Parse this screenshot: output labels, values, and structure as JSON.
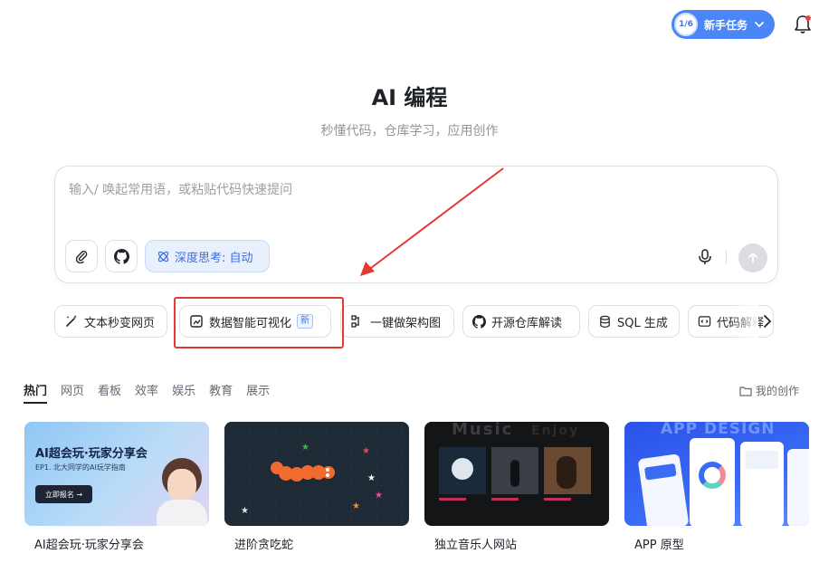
{
  "header": {
    "task_progress": "1/6",
    "task_label": "新手任务",
    "bell_icon": "bell-icon"
  },
  "hero": {
    "title": "AI 编程",
    "subtitle": "秒懂代码，仓库学习，应用创作"
  },
  "composer": {
    "placeholder": "输入/ 唤起常用语，或粘贴代码快速提问",
    "value": "",
    "attach_icon": "paperclip-icon",
    "github_icon": "github-icon",
    "deep_think_label": "深度思考: 自动",
    "mic_icon": "microphone-icon",
    "send_icon": "arrow-up-icon"
  },
  "quick_tools": [
    {
      "label": "文本秒变网页",
      "icon": "magic-wand-icon"
    },
    {
      "label": "数据智能可视化",
      "icon": "chart-image-icon",
      "badge": "新"
    },
    {
      "label": "一键做架构图",
      "icon": "architecture-icon"
    },
    {
      "label": "开源仓库解读",
      "icon": "github-icon"
    },
    {
      "label": "SQL 生成",
      "icon": "database-icon"
    },
    {
      "label": "代码解释",
      "icon": "code-icon"
    }
  ],
  "tabs": [
    "热门",
    "网页",
    "看板",
    "效率",
    "娱乐",
    "教育",
    "展示"
  ],
  "active_tab": "热门",
  "my_creations": "我的创作",
  "cards": [
    {
      "title": "AI超会玩·玩家分享会",
      "thumb_heading": "AI超会玩·玩家分享会",
      "thumb_sub": "EP1. 北大同学的AI玩学指南",
      "thumb_button": "立即报名 →"
    },
    {
      "title": "进阶贪吃蛇"
    },
    {
      "title": "独立音乐人网站",
      "thumb_heading": "Music",
      "thumb_faded": "Enjoy"
    },
    {
      "title": "APP 原型",
      "thumb_heading": "APP DESIGN"
    }
  ],
  "colors": {
    "accent": "#4a86f7",
    "highlight_box": "#e53935",
    "annotation_arrow": "#e53935"
  }
}
